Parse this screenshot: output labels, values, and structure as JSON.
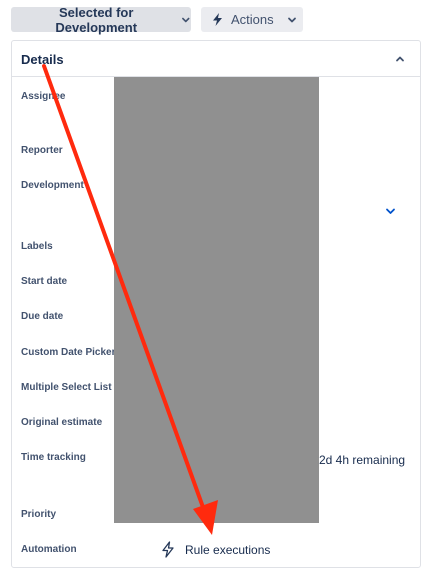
{
  "toolbar": {
    "status_label": "Selected for Development",
    "actions_label": "Actions"
  },
  "details": {
    "title": "Details",
    "fields": [
      {
        "label": "Assignee"
      },
      {
        "label": "Reporter"
      },
      {
        "label": "Development"
      },
      {
        "label": "Labels"
      },
      {
        "label": "Start date"
      },
      {
        "label": "Due date"
      },
      {
        "label": "Custom Date Picker"
      },
      {
        "label": "Multiple Select List"
      },
      {
        "label": "Original estimate"
      },
      {
        "label": "Time tracking",
        "value": "2d 4h remaining"
      },
      {
        "label": "Priority"
      },
      {
        "label": "Automation",
        "value": "Rule executions"
      }
    ]
  },
  "icons": {
    "status_chevron": "chevron-down-icon",
    "actions": "lightning-bolt-icon",
    "collapse": "chevron-up-icon",
    "development_expand": "chevron-down-icon",
    "automation": "lightning-bolt-outline-icon"
  },
  "colors": {
    "accent_blue": "#0052cc",
    "annotation_red": "#ff2a0e",
    "redaction": "#909090"
  }
}
